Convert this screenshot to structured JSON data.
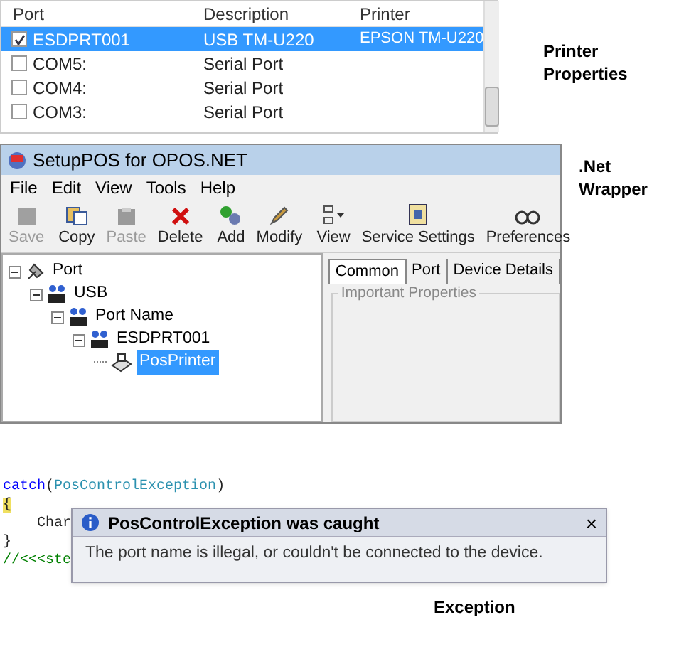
{
  "port_list": {
    "columns": [
      "Port",
      "Description",
      "Printer"
    ],
    "rows": [
      {
        "cells": [
          "ESDPRT001",
          "USB TM-U220",
          "EPSON TM-U220"
        ],
        "checked": true,
        "selected": true
      },
      {
        "cells": [
          "COM5:",
          "Serial Port",
          ""
        ],
        "checked": false,
        "selected": false
      },
      {
        "cells": [
          "COM4:",
          "Serial Port",
          ""
        ],
        "checked": false,
        "selected": false
      },
      {
        "cells": [
          "COM3:",
          "Serial Port",
          ""
        ],
        "checked": false,
        "selected": false
      }
    ]
  },
  "printer_caption": [
    "Printer",
    "Properties"
  ],
  "setup_window": {
    "title": "SetupPOS for OPOS.NET",
    "menu": [
      "File",
      "Edit",
      "View",
      "Tools",
      "Help"
    ],
    "toolbar": [
      {
        "label": "Save",
        "kind": "save",
        "disabled": true
      },
      {
        "label": "Copy",
        "kind": "copy",
        "disabled": false
      },
      {
        "label": "Paste",
        "kind": "paste",
        "disabled": true
      },
      {
        "label": "Delete",
        "kind": "delete",
        "disabled": false
      },
      {
        "label": "Add",
        "kind": "add",
        "disabled": false
      },
      {
        "label": "Modify",
        "kind": "modify",
        "disabled": false
      },
      {
        "label": "View",
        "kind": "view",
        "disabled": false
      },
      {
        "label": "Service Settings",
        "kind": "settings",
        "disabled": false
      },
      {
        "label": "Preferences",
        "kind": "preferences",
        "disabled": false
      }
    ],
    "tree": [
      {
        "label": "Port",
        "kind": "port",
        "selected": false,
        "children": [
          {
            "label": "USB",
            "kind": "net",
            "selected": false,
            "children": [
              {
                "label": "Port Name",
                "kind": "net",
                "selected": false,
                "children": [
                  {
                    "label": "ESDPRT001",
                    "kind": "net",
                    "selected": false,
                    "children": [
                      {
                        "label": "PosPrinter",
                        "kind": "printer",
                        "selected": true
                      }
                    ]
                  }
                ]
              }
            ]
          }
        ]
      }
    ],
    "tabs": [
      {
        "label": "Common",
        "selected": true
      },
      {
        "label": "Port",
        "selected": false
      },
      {
        "label": "Device Details",
        "selected": false
      }
    ],
    "group_title": "Important Properties"
  },
  "net_caption": [
    ".Net",
    "Wrapper"
  ],
  "code": [
    [
      {
        "kind": "keyword",
        "text": "catch"
      },
      {
        "kind": "plain",
        "text": "("
      },
      {
        "kind": "type",
        "text": "PosControlException"
      },
      {
        "kind": "plain",
        "text": ")"
      }
    ],
    [
      {
        "kind": "brace",
        "text": "{"
      }
    ],
    [
      {
        "kind": "plain",
        "text": "Char"
      }
    ],
    [
      {
        "kind": "plain",
        "text": "}"
      }
    ],
    [
      {
        "kind": "comment",
        "text": "//<<<ste"
      }
    ]
  ],
  "exception_popup": {
    "title": "PosControlException was caught",
    "close": "×",
    "message": "The port name is illegal, or couldn't be connected to the device."
  },
  "exception_caption": "Exception"
}
